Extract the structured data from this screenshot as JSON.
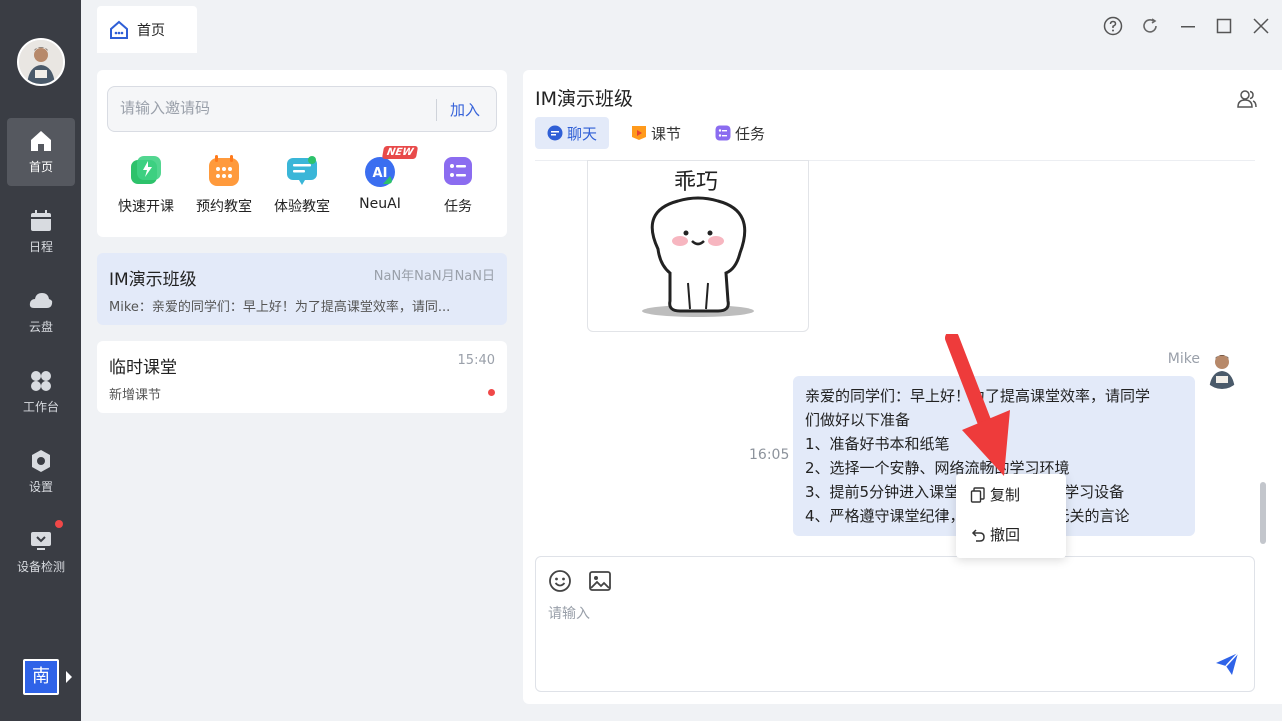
{
  "sidebar": {
    "items": [
      {
        "label": "首页",
        "icon": "home-icon",
        "active": true
      },
      {
        "label": "日程",
        "icon": "calendar-icon"
      },
      {
        "label": "云盘",
        "icon": "cloud-icon"
      },
      {
        "label": "工作台",
        "icon": "workbench-icon"
      },
      {
        "label": "设置",
        "icon": "settings-icon"
      },
      {
        "label": "设备检测",
        "icon": "device-check-icon",
        "badge": true
      }
    ],
    "lang_button": "南"
  },
  "topbar": {
    "home_tab": "首页"
  },
  "invite": {
    "placeholder": "请输入邀请码",
    "join_label": "加入"
  },
  "quick_actions": [
    {
      "label": "快速开课",
      "color": "#2dc26b"
    },
    {
      "label": "预约教室",
      "color": "#ff9a3c"
    },
    {
      "label": "体验教室",
      "color": "#3ab6d8"
    },
    {
      "label": "NeuAI",
      "color": "#3b6ef0",
      "badge": "NEW"
    },
    {
      "label": "任务",
      "color": "#8b6cf0"
    }
  ],
  "conversations": [
    {
      "title": "IM演示班级",
      "time": "NaN年NaN月NaN日",
      "preview": "Mike：亲爱的同学们：早上好！为了提高课堂效率，请同...",
      "active": true
    },
    {
      "title": "临时课堂",
      "time": "15:40",
      "preview": "新增课节",
      "unread": true
    }
  ],
  "chat": {
    "title": "IM演示班级",
    "tabs": [
      {
        "label": "聊天",
        "active": true
      },
      {
        "label": "课节"
      },
      {
        "label": "任务"
      }
    ],
    "sticker_text": "乖巧",
    "sender": "Mike",
    "message_time": "16:05",
    "message_lines": [
      "亲爱的同学们：早上好！为了提高课堂效率，请同学",
      "们做好以下准备",
      "1、准备好书本和纸笔",
      "2、选择一个安静、网络流畅的学习环境",
      "3、提前5分钟进入课堂，检查好自己的学习设备",
      "4、严格遵守课堂纪律，不发表与课程无关的言论"
    ],
    "composer_placeholder": "请输入"
  },
  "context_menu": {
    "items": [
      {
        "label": "复制",
        "icon": "copy-icon"
      },
      {
        "label": "撤回",
        "icon": "undo-icon"
      }
    ]
  },
  "colors": {
    "sidebar": "#3a3d44",
    "accent": "#2f5fd6",
    "active_bg": "#e3eaf9",
    "badge_red": "#f04848"
  }
}
